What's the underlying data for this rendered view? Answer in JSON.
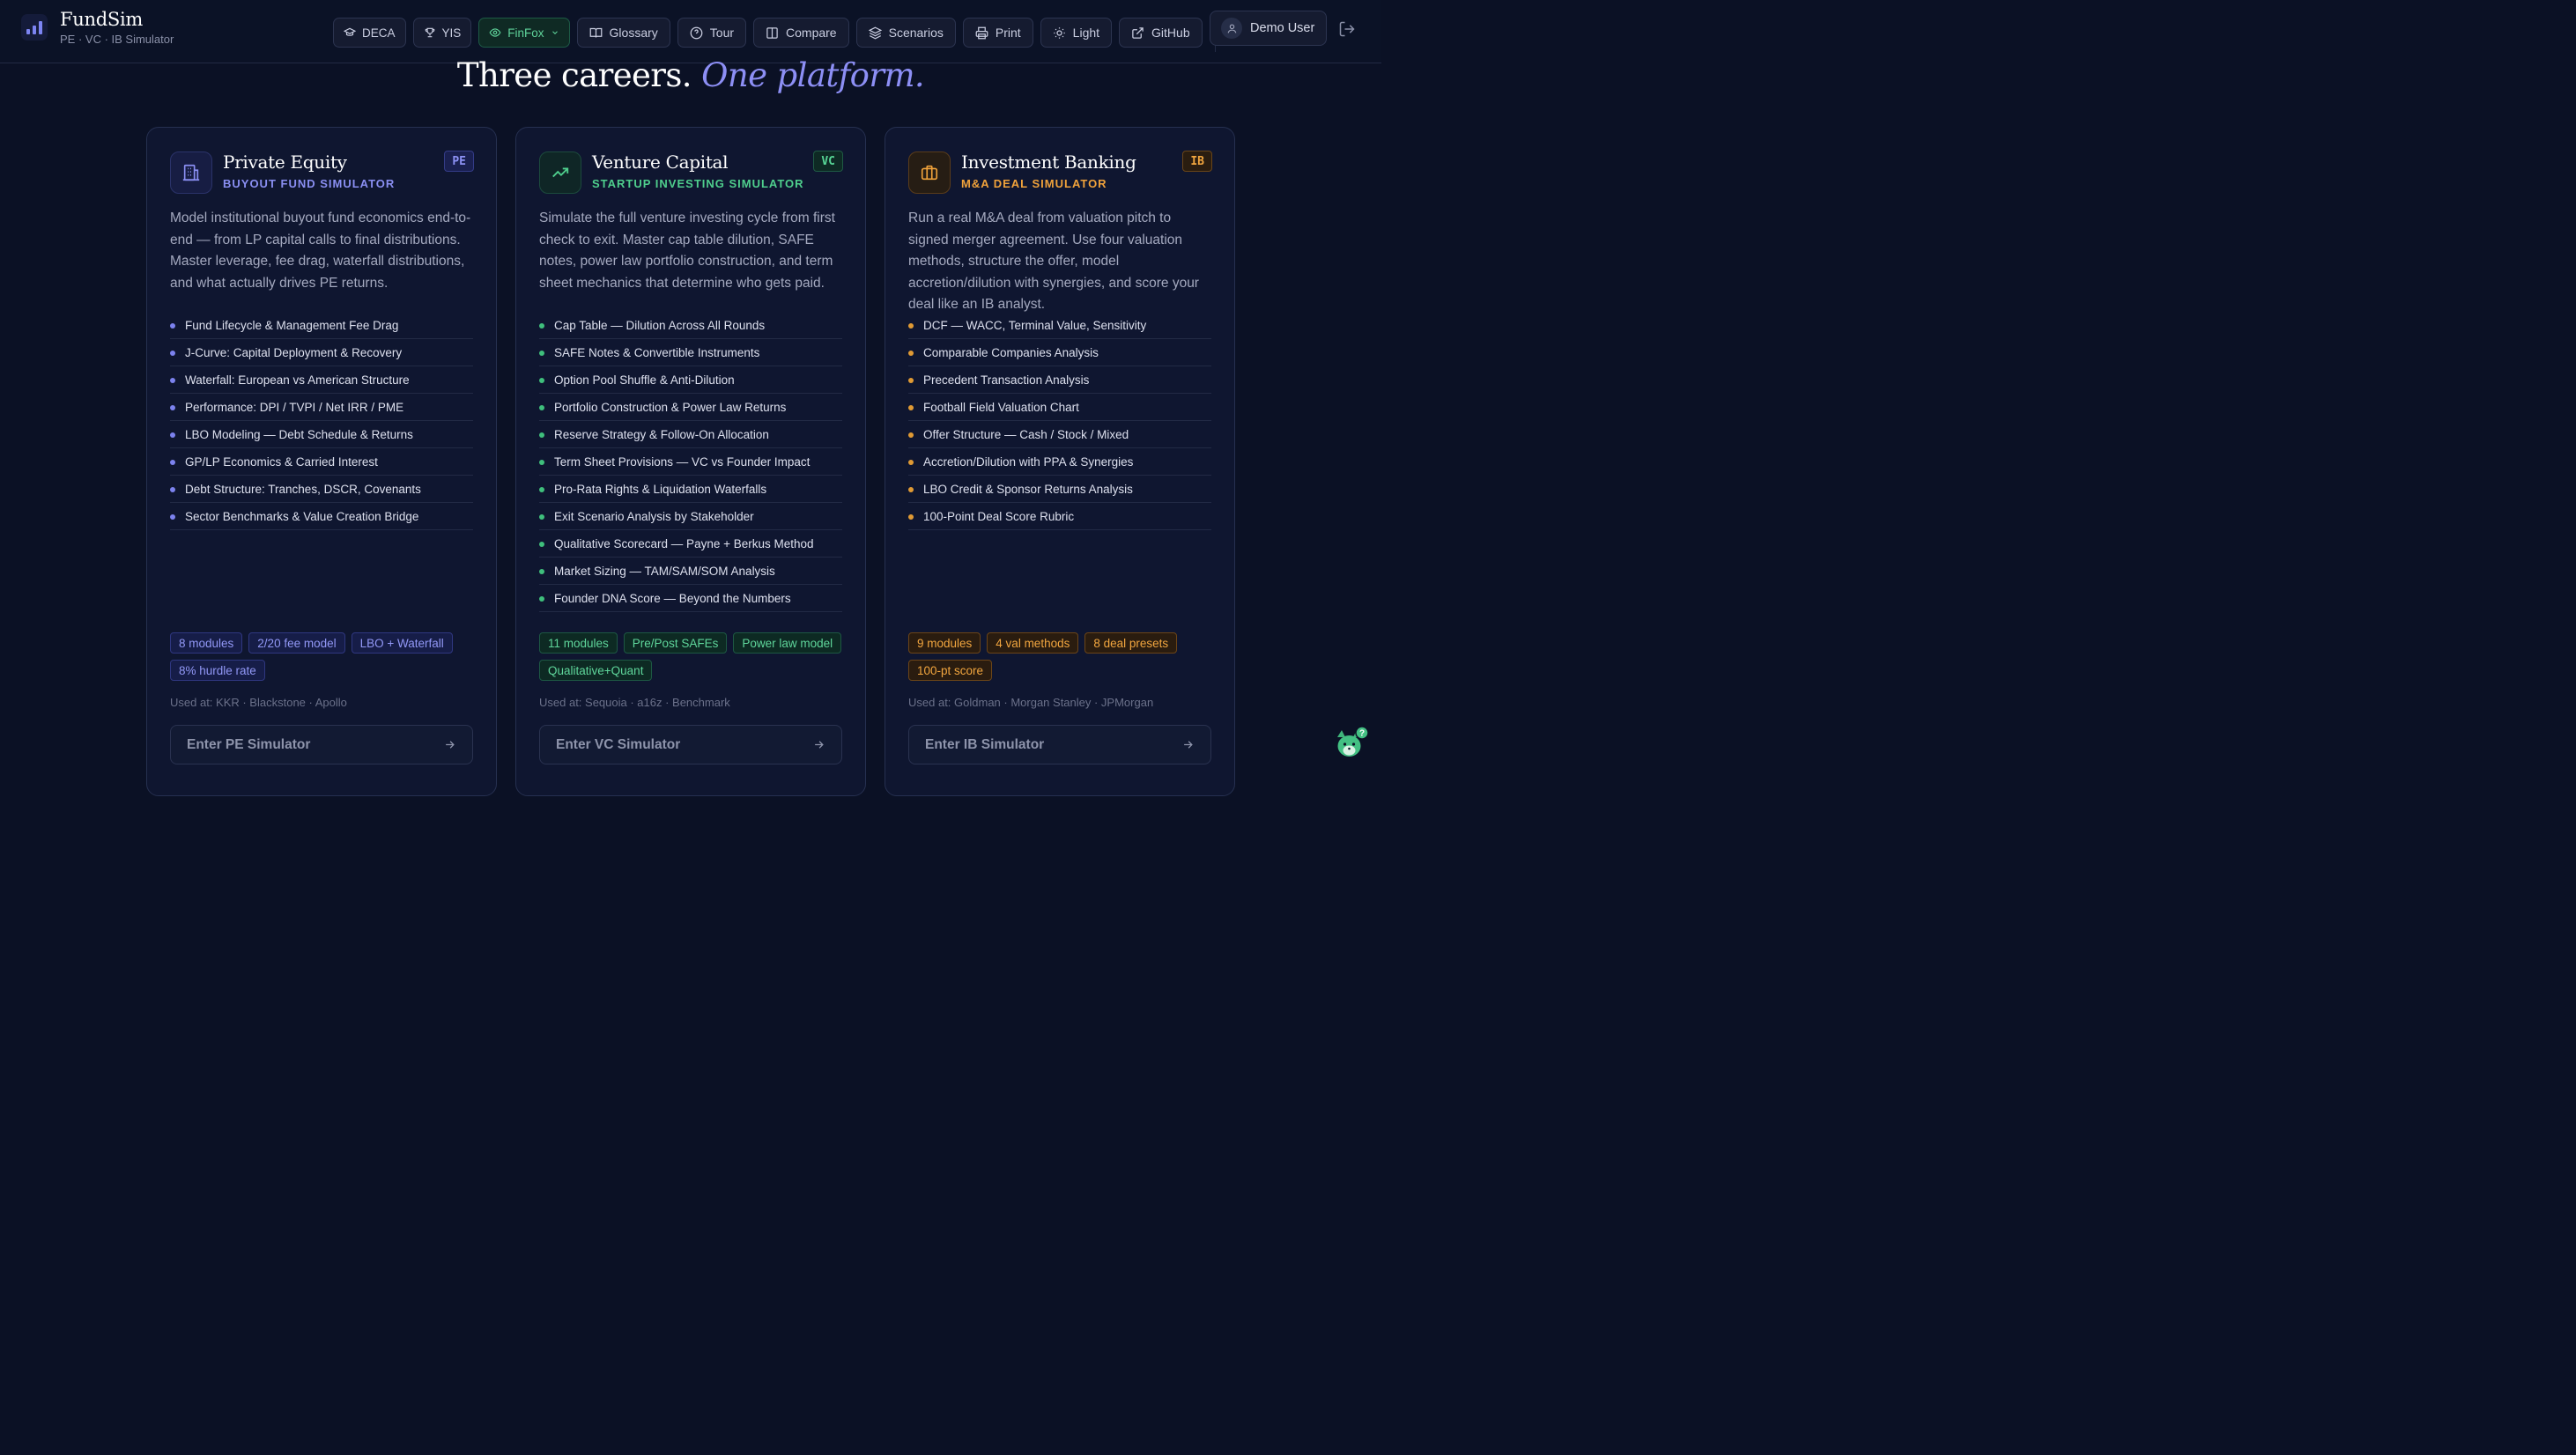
{
  "header": {
    "brand_name": "FundSim",
    "brand_sub": "PE · VC · IB Simulator",
    "nav": [
      {
        "label": "DECA",
        "icon": "graduation-cap-icon"
      },
      {
        "label": "YIS",
        "icon": "trophy-icon"
      },
      {
        "label": "FinFox",
        "icon": "eye-icon",
        "active": true
      },
      {
        "label": "Glossary",
        "icon": "book-icon"
      },
      {
        "label": "Tour",
        "icon": "help-circle-icon"
      },
      {
        "label": "Compare",
        "icon": "columns-icon"
      },
      {
        "label": "Scenarios",
        "icon": "layers-icon"
      },
      {
        "label": "Print",
        "icon": "printer-icon"
      },
      {
        "label": "Light",
        "icon": "sun-icon"
      },
      {
        "label": "GitHub",
        "icon": "external-link-icon"
      }
    ],
    "user_name": "Demo User"
  },
  "hero": {
    "title_plain": "Three careers.",
    "title_accent": "One platform."
  },
  "cards": [
    {
      "title": "Private Equity",
      "tag": "BUYOUT FUND SIMULATOR",
      "badge": "PE",
      "icon": "building-icon",
      "accent": "#8a8ff2",
      "description": "Model institutional buyout fund economics end-to-end — from LP capital calls to final distributions. Master leverage, fee drag, waterfall distributions, and what actually drives PE returns.",
      "features": [
        "Fund Lifecycle & Management Fee Drag",
        "J-Curve: Capital Deployment & Recovery",
        "Waterfall: European vs American Structure",
        "Performance: DPI / TVPI / Net IRR / PME",
        "LBO Modeling — Debt Schedule & Returns",
        "GP/LP Economics & Carried Interest",
        "Debt Structure: Tranches, DSCR, Covenants",
        "Sector Benchmarks & Value Creation Bridge"
      ],
      "chips": [
        "8 modules",
        "2/20 fee model",
        "LBO + Waterfall",
        "8% hurdle rate"
      ],
      "used_at": "Used at: KKR · Blackstone · Apollo",
      "cta": "Enter PE Simulator"
    },
    {
      "title": "Venture Capital",
      "tag": "STARTUP INVESTING SIMULATOR",
      "badge": "VC",
      "icon": "trending-up-icon",
      "accent": "#4fcf8d",
      "description": "Simulate the full venture investing cycle from first check to exit. Master cap table dilution, SAFE notes, power law portfolio construction, and term sheet mechanics that determine who gets paid.",
      "features": [
        "Cap Table — Dilution Across All Rounds",
        "SAFE Notes & Convertible Instruments",
        "Option Pool Shuffle & Anti-Dilution",
        "Portfolio Construction & Power Law Returns",
        "Reserve Strategy & Follow-On Allocation",
        "Term Sheet Provisions — VC vs Founder Impact",
        "Pro-Rata Rights & Liquidation Waterfalls",
        "Exit Scenario Analysis by Stakeholder",
        "Qualitative Scorecard — Payne + Berkus Method",
        "Market Sizing — TAM/SAM/SOM Analysis",
        "Founder DNA Score — Beyond the Numbers"
      ],
      "chips": [
        "11 modules",
        "Pre/Post SAFEs",
        "Power law model",
        "Qualitative+Quant"
      ],
      "used_at": "Used at: Sequoia · a16z · Benchmark",
      "cta": "Enter VC Simulator"
    },
    {
      "title": "Investment Banking",
      "tag": "M&A DEAL SIMULATOR",
      "badge": "IB",
      "icon": "briefcase-icon",
      "accent": "#f0a23b",
      "description": "Run a real M&A deal from valuation pitch to signed merger agreement. Use four valuation methods, structure the offer, model accretion/dilution with synergies, and score your deal like an IB analyst.",
      "features": [
        "DCF — WACC, Terminal Value, Sensitivity",
        "Comparable Companies Analysis",
        "Precedent Transaction Analysis",
        "Football Field Valuation Chart",
        "Offer Structure — Cash / Stock / Mixed",
        "Accretion/Dilution with PPA & Synergies",
        "LBO Credit & Sponsor Returns Analysis",
        "100-Point Deal Score Rubric"
      ],
      "chips": [
        "9 modules",
        "4 val methods",
        "8 deal presets",
        "100-pt score"
      ],
      "used_at": "Used at: Goldman · Morgan Stanley · JPMorgan",
      "cta": "Enter IB Simulator"
    }
  ]
}
